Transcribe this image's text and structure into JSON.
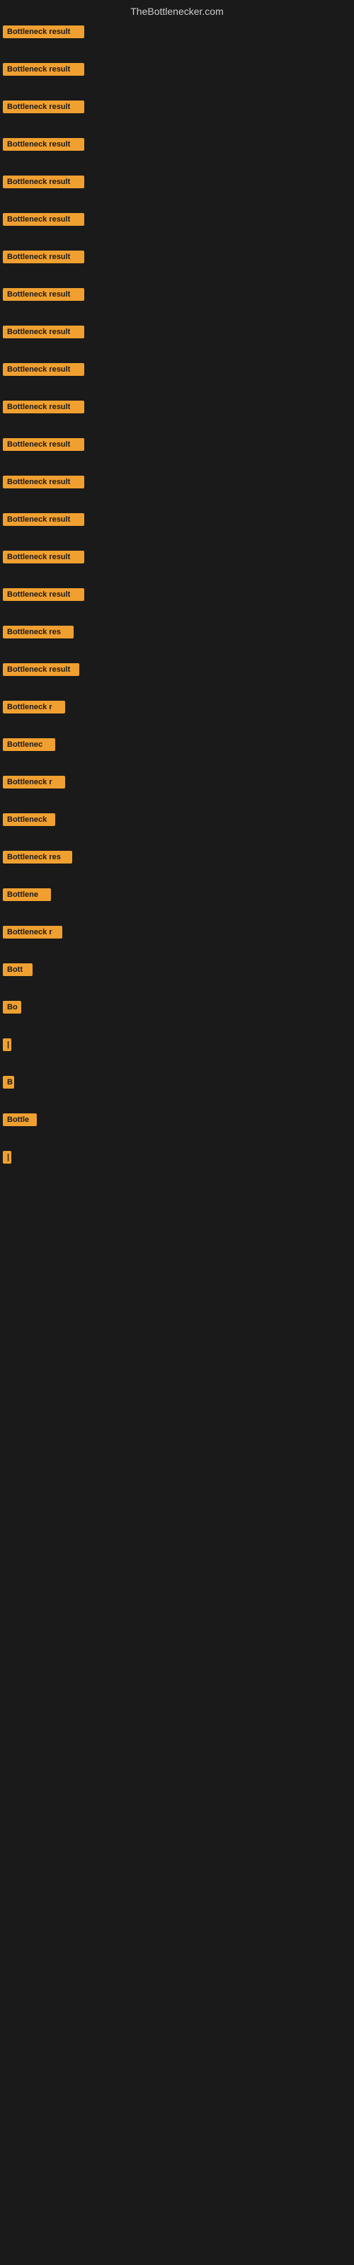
{
  "header": {
    "title": "TheBottlenecker.com"
  },
  "items": [
    {
      "label": "Bottleneck result",
      "width": 115
    },
    {
      "label": "Bottleneck result",
      "width": 115
    },
    {
      "label": "Bottleneck result",
      "width": 115
    },
    {
      "label": "Bottleneck result",
      "width": 115
    },
    {
      "label": "Bottleneck result",
      "width": 115
    },
    {
      "label": "Bottleneck result",
      "width": 115
    },
    {
      "label": "Bottleneck result",
      "width": 115
    },
    {
      "label": "Bottleneck result",
      "width": 115
    },
    {
      "label": "Bottleneck result",
      "width": 115
    },
    {
      "label": "Bottleneck result",
      "width": 115
    },
    {
      "label": "Bottleneck result",
      "width": 115
    },
    {
      "label": "Bottleneck result",
      "width": 115
    },
    {
      "label": "Bottleneck result",
      "width": 115
    },
    {
      "label": "Bottleneck result",
      "width": 115
    },
    {
      "label": "Bottleneck result",
      "width": 115
    },
    {
      "label": "Bottleneck result",
      "width": 115
    },
    {
      "label": "Bottleneck res",
      "width": 100
    },
    {
      "label": "Bottleneck result",
      "width": 108
    },
    {
      "label": "Bottleneck r",
      "width": 88
    },
    {
      "label": "Bottlenec",
      "width": 74
    },
    {
      "label": "Bottleneck r",
      "width": 88
    },
    {
      "label": "Bottleneck",
      "width": 74
    },
    {
      "label": "Bottleneck res",
      "width": 98
    },
    {
      "label": "Bottlene",
      "width": 68
    },
    {
      "label": "Bottleneck r",
      "width": 84
    },
    {
      "label": "Bott",
      "width": 42
    },
    {
      "label": "Bo",
      "width": 26
    },
    {
      "label": "|",
      "width": 8
    },
    {
      "label": "B",
      "width": 16
    },
    {
      "label": "Bottle",
      "width": 48
    },
    {
      "label": "|",
      "width": 8
    }
  ]
}
